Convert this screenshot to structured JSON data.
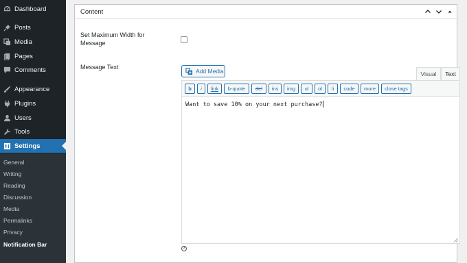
{
  "sidebar": {
    "menu": [
      {
        "label": "Dashboard",
        "icon": "dashboard-icon"
      },
      {
        "label": "Posts",
        "icon": "pushpin-icon"
      },
      {
        "label": "Media",
        "icon": "media-icon"
      },
      {
        "label": "Pages",
        "icon": "pages-icon"
      },
      {
        "label": "Comments",
        "icon": "comment-icon"
      },
      {
        "label": "Appearance",
        "icon": "paintbrush-icon"
      },
      {
        "label": "Plugins",
        "icon": "plug-icon"
      },
      {
        "label": "Users",
        "icon": "users-icon"
      },
      {
        "label": "Tools",
        "icon": "wrench-icon"
      },
      {
        "label": "Settings",
        "icon": "settings-icon"
      }
    ],
    "submenu": [
      "General",
      "Writing",
      "Reading",
      "Discussion",
      "Media",
      "Permalinks",
      "Privacy",
      "Notification Bar"
    ],
    "current_submenu": "Notification Bar"
  },
  "panel": {
    "title": "Content",
    "max_width_label": "Set Maximum Width for Message",
    "max_width_checked": false,
    "message_label": "Message Text",
    "add_media_label": "Add Media",
    "tabs": {
      "visual": "Visual",
      "text": "Text"
    },
    "active_tab": "Text",
    "quicktags": [
      "b",
      "i",
      "link",
      "b-quote",
      "del",
      "ins",
      "img",
      "ul",
      "ol",
      "li",
      "code",
      "more",
      "close tags"
    ],
    "editor_text": "Want to save 10% on your next purchase?",
    "help_symbol": "?"
  },
  "colors": {
    "sidebar_bg": "#1d2327",
    "accent": "#2271b1",
    "panel_bg": "#ffffff"
  }
}
